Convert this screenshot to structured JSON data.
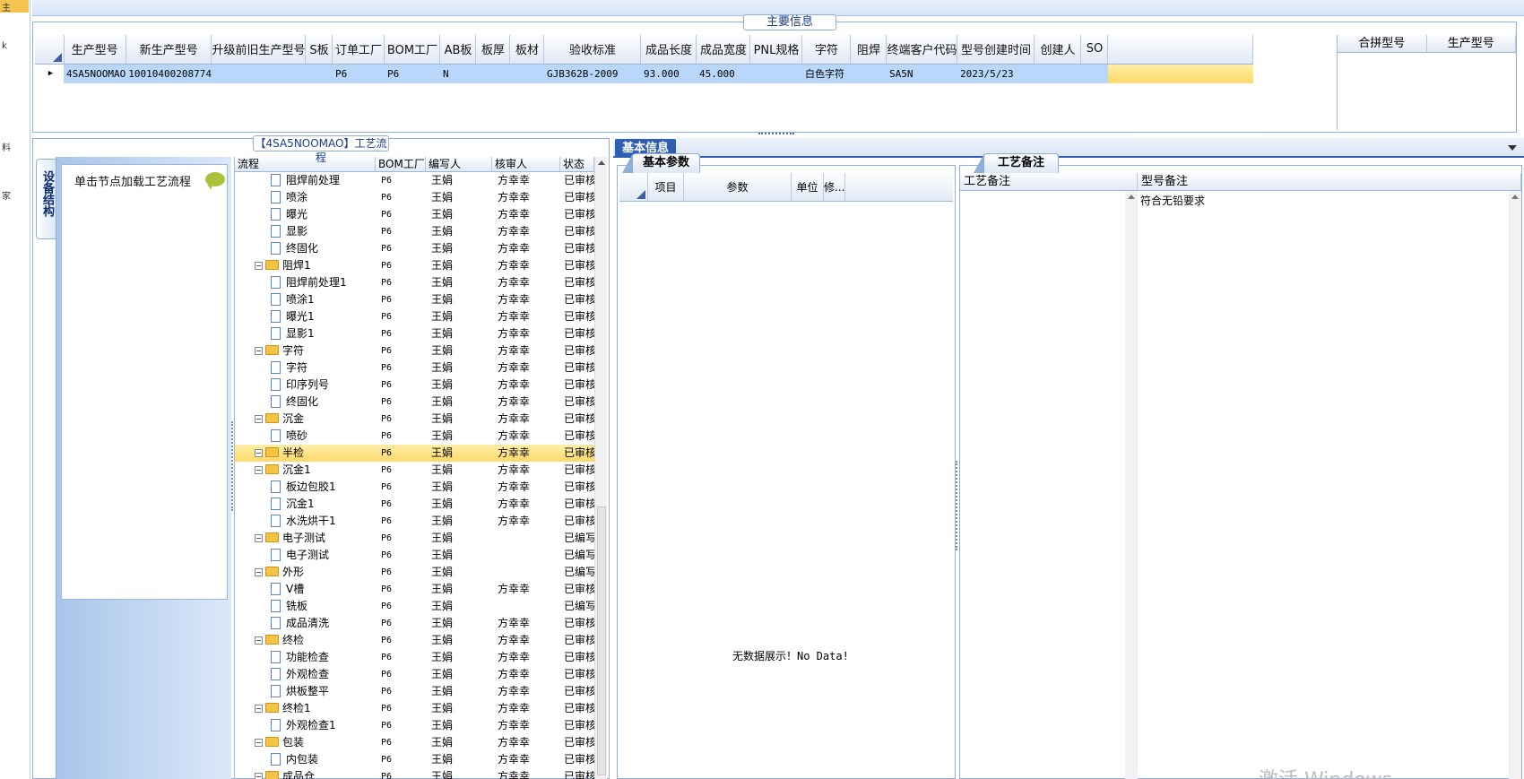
{
  "left_strip": {
    "chars": [
      "主",
      "k",
      "料",
      "家"
    ]
  },
  "main_info": {
    "title": "主要信息",
    "columns": [
      "生产型号",
      "新生产型号",
      "升级前旧生产型号",
      "S板",
      "订单工厂",
      "BOM工厂",
      "AB板",
      "板厚",
      "板材",
      "验收标准",
      "成品长度",
      "成品宽度",
      "PNL规格",
      "字符",
      "阻焊",
      "终端客户代码",
      "型号创建时间",
      "创建人",
      "SO"
    ],
    "row": [
      "4SA5NOOMAO",
      "10010400208774",
      "",
      "",
      "P6",
      "P6",
      "N",
      "",
      "",
      "GJB362B-2009",
      "93.000",
      "45.000",
      "",
      "白色字符",
      "",
      "SA5N",
      "2023/5/23",
      "",
      ""
    ],
    "right_columns": [
      "合拼型号",
      "生产型号"
    ]
  },
  "process": {
    "title": "【4SA5NOOMAO】工艺流程",
    "side_tab": "设备结构",
    "hint": "单击节点加载工艺流程",
    "columns": [
      "流程",
      "BOM工厂",
      "编写人",
      "核审人",
      "状态"
    ],
    "rows": [
      {
        "name": "阻焊前处理",
        "lvl": 2,
        "bom": "P6",
        "editor": "王娟",
        "reviewer": "方幸幸",
        "status": "已审核"
      },
      {
        "name": "喷涂",
        "lvl": 2,
        "bom": "P6",
        "editor": "王娟",
        "reviewer": "方幸幸",
        "status": "已审核"
      },
      {
        "name": "曝光",
        "lvl": 2,
        "bom": "P6",
        "editor": "王娟",
        "reviewer": "方幸幸",
        "status": "已审核"
      },
      {
        "name": "显影",
        "lvl": 2,
        "bom": "P6",
        "editor": "王娟",
        "reviewer": "方幸幸",
        "status": "已审核"
      },
      {
        "name": "终固化",
        "lvl": 2,
        "bom": "P6",
        "editor": "王娟",
        "reviewer": "方幸幸",
        "status": "已审核"
      },
      {
        "name": "阻焊1",
        "lvl": 1,
        "bom": "P6",
        "editor": "王娟",
        "reviewer": "方幸幸",
        "status": "已审核"
      },
      {
        "name": "阻焊前处理1",
        "lvl": 2,
        "bom": "P6",
        "editor": "王娟",
        "reviewer": "方幸幸",
        "status": "已审核"
      },
      {
        "name": "喷涂1",
        "lvl": 2,
        "bom": "P6",
        "editor": "王娟",
        "reviewer": "方幸幸",
        "status": "已审核"
      },
      {
        "name": "曝光1",
        "lvl": 2,
        "bom": "P6",
        "editor": "王娟",
        "reviewer": "方幸幸",
        "status": "已审核"
      },
      {
        "name": "显影1",
        "lvl": 2,
        "bom": "P6",
        "editor": "王娟",
        "reviewer": "方幸幸",
        "status": "已审核"
      },
      {
        "name": "字符",
        "lvl": 1,
        "bom": "P6",
        "editor": "王娟",
        "reviewer": "方幸幸",
        "status": "已审核"
      },
      {
        "name": "字符",
        "lvl": 2,
        "bom": "P6",
        "editor": "王娟",
        "reviewer": "方幸幸",
        "status": "已审核"
      },
      {
        "name": "印序列号",
        "lvl": 2,
        "bom": "P6",
        "editor": "王娟",
        "reviewer": "方幸幸",
        "status": "已审核"
      },
      {
        "name": "终固化",
        "lvl": 2,
        "bom": "P6",
        "editor": "王娟",
        "reviewer": "方幸幸",
        "status": "已审核"
      },
      {
        "name": "沉金",
        "lvl": 1,
        "bom": "P6",
        "editor": "王娟",
        "reviewer": "方幸幸",
        "status": "已审核"
      },
      {
        "name": "喷砂",
        "lvl": 2,
        "bom": "P6",
        "editor": "王娟",
        "reviewer": "方幸幸",
        "status": "已审核"
      },
      {
        "name": "半检",
        "lvl": 1,
        "bom": "P6",
        "editor": "王娟",
        "reviewer": "方幸幸",
        "status": "已审核",
        "selected": true
      },
      {
        "name": "沉金1",
        "lvl": 1,
        "bom": "P6",
        "editor": "王娟",
        "reviewer": "方幸幸",
        "status": "已审核"
      },
      {
        "name": "板边包胶1",
        "lvl": 2,
        "bom": "P6",
        "editor": "王娟",
        "reviewer": "方幸幸",
        "status": "已审核"
      },
      {
        "name": "沉金1",
        "lvl": 2,
        "bom": "P6",
        "editor": "王娟",
        "reviewer": "方幸幸",
        "status": "已审核"
      },
      {
        "name": "水洗烘干1",
        "lvl": 2,
        "bom": "P6",
        "editor": "王娟",
        "reviewer": "方幸幸",
        "status": "已审核"
      },
      {
        "name": "电子测试",
        "lvl": 1,
        "bom": "P6",
        "editor": "王娟",
        "reviewer": "",
        "status": "已编写"
      },
      {
        "name": "电子测试",
        "lvl": 2,
        "bom": "P6",
        "editor": "王娟",
        "reviewer": "",
        "status": "已编写"
      },
      {
        "name": "外形",
        "lvl": 1,
        "bom": "P6",
        "editor": "王娟",
        "reviewer": "",
        "status": "已编写"
      },
      {
        "name": "V槽",
        "lvl": 2,
        "bom": "P6",
        "editor": "王娟",
        "reviewer": "方幸幸",
        "status": "已审核"
      },
      {
        "name": "铣板",
        "lvl": 2,
        "bom": "P6",
        "editor": "王娟",
        "reviewer": "",
        "status": "已编写"
      },
      {
        "name": "成品清洗",
        "lvl": 2,
        "bom": "P6",
        "editor": "王娟",
        "reviewer": "方幸幸",
        "status": "已审核"
      },
      {
        "name": "终检",
        "lvl": 1,
        "bom": "P6",
        "editor": "王娟",
        "reviewer": "方幸幸",
        "status": "已审核"
      },
      {
        "name": "功能检查",
        "lvl": 2,
        "bom": "P6",
        "editor": "王娟",
        "reviewer": "方幸幸",
        "status": "已审核"
      },
      {
        "name": "外观检查",
        "lvl": 2,
        "bom": "P6",
        "editor": "王娟",
        "reviewer": "方幸幸",
        "status": "已审核"
      },
      {
        "name": "烘板整平",
        "lvl": 2,
        "bom": "P6",
        "editor": "王娟",
        "reviewer": "方幸幸",
        "status": "已审核"
      },
      {
        "name": "终检1",
        "lvl": 1,
        "bom": "P6",
        "editor": "王娟",
        "reviewer": "方幸幸",
        "status": "已审核"
      },
      {
        "name": "外观检查1",
        "lvl": 2,
        "bom": "P6",
        "editor": "王娟",
        "reviewer": "方幸幸",
        "status": "已审核"
      },
      {
        "name": "包装",
        "lvl": 1,
        "bom": "P6",
        "editor": "王娟",
        "reviewer": "方幸幸",
        "status": "已审核"
      },
      {
        "name": "内包装",
        "lvl": 2,
        "bom": "P6",
        "editor": "王娟",
        "reviewer": "方幸幸",
        "status": "已审核"
      },
      {
        "name": "成品仓",
        "lvl": 1,
        "bom": "P6",
        "editor": "王娟",
        "reviewer": "方幸幸",
        "status": "已审核"
      }
    ]
  },
  "basic_info": {
    "tab": "基本信息",
    "param_tab": "基本参数",
    "param_columns": [
      "项目",
      "参数",
      "单位",
      "修..."
    ],
    "no_data": "无数据展示！No Data!",
    "remark_tab": "工艺备注",
    "remark_columns": [
      "工艺备注",
      "型号备注"
    ],
    "model_remark": "符合无铅要求"
  },
  "watermark": "激活 Windows",
  "colors": {
    "accent": "#2e5fb0",
    "selected_row": "#b9d7fb",
    "highlight": "#fcd86a"
  }
}
